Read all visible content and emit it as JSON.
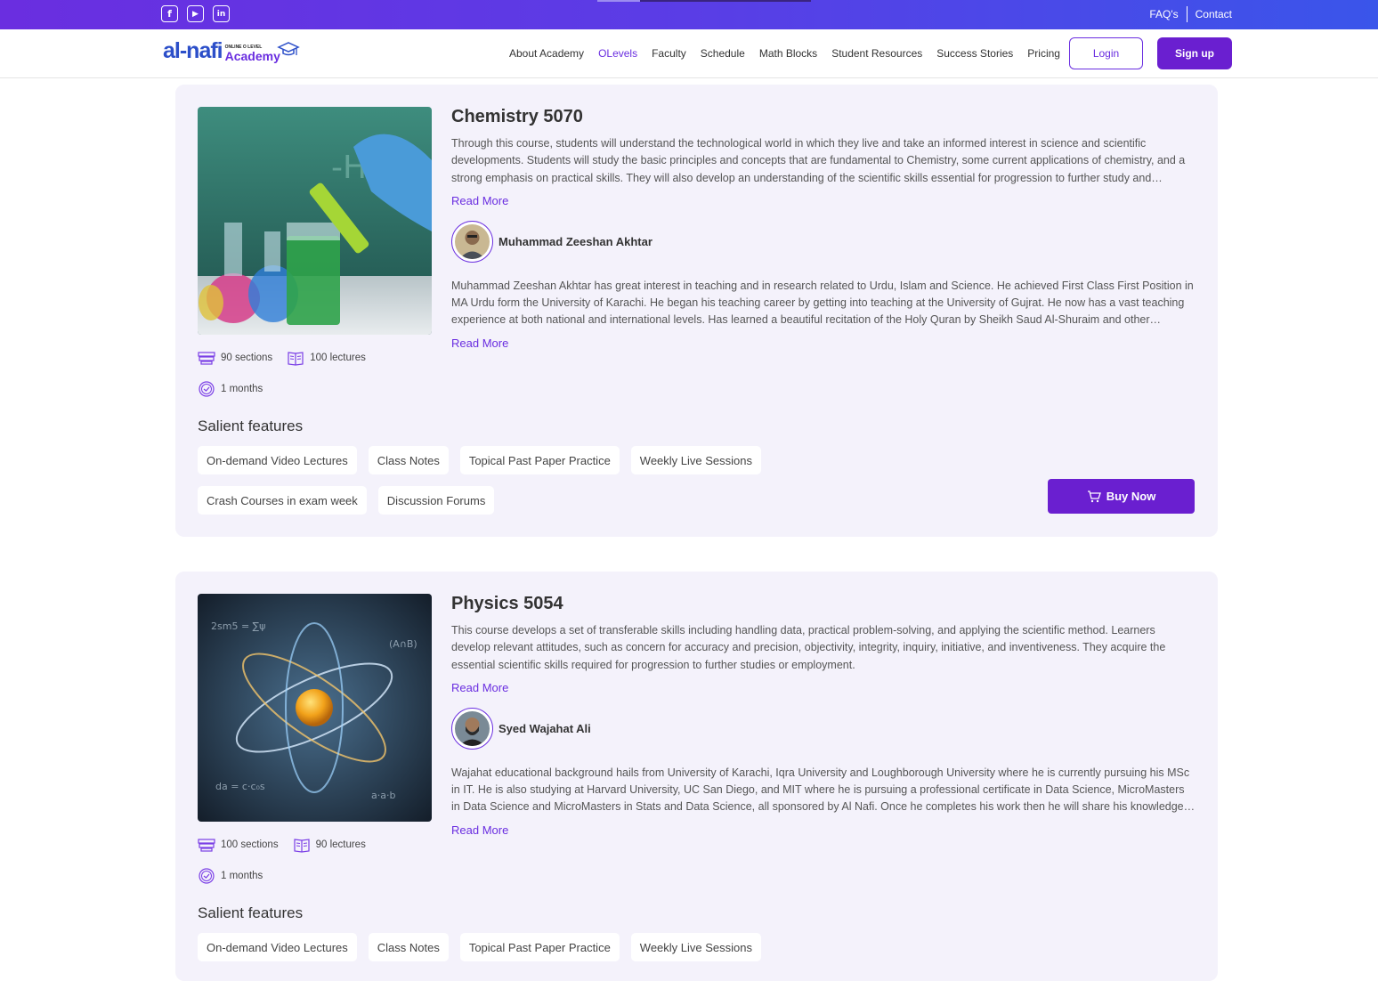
{
  "topbar": {
    "social": [
      {
        "name": "facebook-icon",
        "glyph": "f"
      },
      {
        "name": "youtube-icon",
        "glyph": "▶"
      },
      {
        "name": "linkedin-icon",
        "glyph": "in"
      }
    ],
    "faq_label": "FAQ's",
    "contact_label": "Contact"
  },
  "header": {
    "logo_main": "al-nafi",
    "logo_small": "ONLINE O LEVEL",
    "logo_academy": "Academy",
    "nav": [
      {
        "label": "About Academy",
        "active": false
      },
      {
        "label": "OLevels",
        "active": true
      },
      {
        "label": "Faculty",
        "active": false
      },
      {
        "label": "Schedule",
        "active": false
      },
      {
        "label": "Math Blocks",
        "active": false
      },
      {
        "label": "Student Resources",
        "active": false
      },
      {
        "label": "Success Stories",
        "active": false
      },
      {
        "label": "Pricing",
        "active": false
      }
    ],
    "login_label": "Login",
    "signup_label": "Sign up"
  },
  "courses": [
    {
      "title": "Chemistry 5070",
      "description": "Through this course, students will understand the technological world in which they live and take an informed interest in science and scientific developments. Students will study the basic principles and concepts that are fundamental to Chemistry, some current applications of chemistry, and a strong emphasis on practical skills. They will also develop an understanding of the scientific skills essential for progression to further study and employment.",
      "read_more": "Read More",
      "teacher_name": "Muhammad Zeeshan Akhtar",
      "teacher_bio": "Muhammad Zeeshan Akhtar has great interest in teaching and in research related to Urdu, Islam and Science. He achieved First Class First Position in MA Urdu form the University of Karachi. He began his teaching career by getting into teaching at the University of Gujrat. He now has a vast teaching experience at both national and international levels. Has learned a beautiful recitation of the Holy Quran by Sheikh Saud Al-Shuraim and other renowned reciters.",
      "bio_read_more": "Read More",
      "sections": "90 sections",
      "lectures": "100 lectures",
      "duration": "1 months",
      "salient_title": "Salient features",
      "features": [
        "On-demand Video Lectures",
        "Class Notes",
        "Topical Past Paper Practice",
        "Weekly Live Sessions",
        "Crash Courses in exam week",
        "Discussion Forums"
      ],
      "buy_label": "Buy Now"
    },
    {
      "title": "Physics 5054",
      "description": "This course develops a set of transferable skills including handling data, practical problem-solving, and applying the scientific method. Learners develop relevant attitudes, such as concern for accuracy and precision, objectivity, integrity, inquiry, initiative, and inventiveness. They acquire the essential scientific skills required for progression to further studies or employment.",
      "read_more": "Read More",
      "teacher_name": "Syed Wajahat Ali",
      "teacher_bio": "Wajahat educational background hails from University of Karachi, Iqra University and Loughborough University where he is currently pursuing his MSc in IT. He is also studying at Harvard University, UC San Diego, and MIT where he is pursuing a professional certificate in Data Science, MicroMasters in Data Science and MicroMasters in Stats and Data Science, all sponsored by Al Nafi. Once he completes his work then he will share his knowledge with the students.",
      "bio_read_more": "Read More",
      "sections": "100 sections",
      "lectures": "90 lectures",
      "duration": "1 months",
      "salient_title": "Salient features",
      "features": [
        "On-demand Video Lectures",
        "Class Notes",
        "Topical Past Paper Practice",
        "Weekly Live Sessions"
      ]
    }
  ],
  "colors": {
    "brand_purple": "#6a1fd0",
    "accent": "#6a2ee0",
    "card_bg": "#f4f2fb"
  }
}
